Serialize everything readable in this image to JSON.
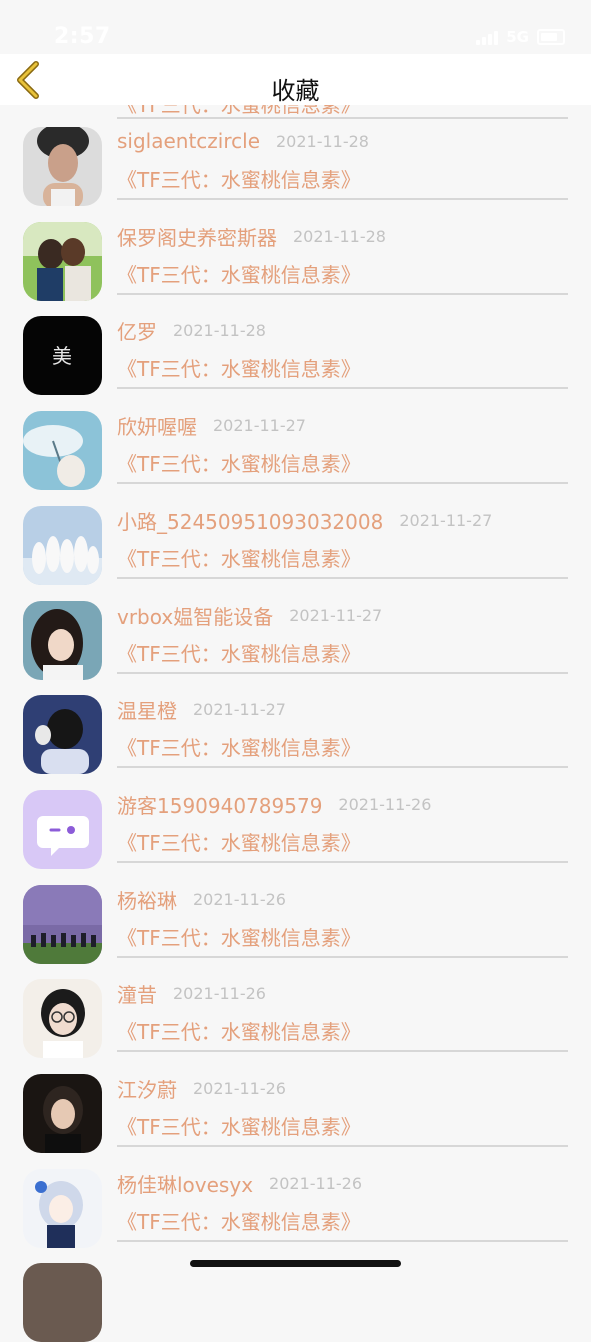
{
  "status_bar": {
    "time": "2:57",
    "network": "5G"
  },
  "header": {
    "title": "收藏",
    "back_icon": "chevron-left-icon",
    "back_color": "#d4a82a"
  },
  "colors": {
    "username": "#e4a07c",
    "date": "#c3c3c3",
    "divider": "#d7d7d7"
  },
  "partial_top_row": {
    "post": "《TF三代：水蜜桃信息素》"
  },
  "favorites": [
    {
      "username": "siglaentczircle",
      "date": "2021-11-28",
      "post": "《TF三代：水蜜桃信息素》",
      "avatar": "portrait-woman"
    },
    {
      "username": "保罗阁史养密斯器",
      "date": "2021-11-28",
      "post": "《TF三代：水蜜桃信息素》",
      "avatar": "couple-kissing"
    },
    {
      "username": "亿罗",
      "date": "2021-11-28",
      "post": "《TF三代：水蜜桃信息素》",
      "avatar": "black-logo"
    },
    {
      "username": "欣妍喔喔",
      "date": "2021-11-27",
      "post": "《TF三代：水蜜桃信息素》",
      "avatar": "blue-umbrella"
    },
    {
      "username": "小路_5245095109303200​8",
      "date": "2021-11-27",
      "post": "《TF三代：水蜜桃信息素》",
      "avatar": "group-white"
    },
    {
      "username": "vrbox媪智能设备",
      "date": "2021-11-27",
      "post": "《TF三代：水蜜桃信息素》",
      "avatar": "girl-dark-hair"
    },
    {
      "username": "温星橙",
      "date": "2021-11-27",
      "post": "《TF三代：水蜜桃信息素》",
      "avatar": "girl-blue-back"
    },
    {
      "username": "游客1590940789579",
      "date": "2021-11-26",
      "post": "《TF三代：水蜜桃信息素》",
      "avatar": "chat-bubble-default"
    },
    {
      "username": "杨裕琳",
      "date": "2021-11-26",
      "post": "《TF三代：水蜜桃信息素》",
      "avatar": "sunset-group"
    },
    {
      "username": "潼昔",
      "date": "2021-11-26",
      "post": "《TF三代：水蜜桃信息素》",
      "avatar": "girl-glasses"
    },
    {
      "username": "江汐蔚",
      "date": "2021-11-26",
      "post": "《TF三代：水蜜桃信息素》",
      "avatar": "girl-dark"
    },
    {
      "username": "杨佳琳lovesyx",
      "date": "2021-11-26",
      "post": "《TF三代：水蜜桃信息素》",
      "avatar": "anime-girl"
    }
  ]
}
